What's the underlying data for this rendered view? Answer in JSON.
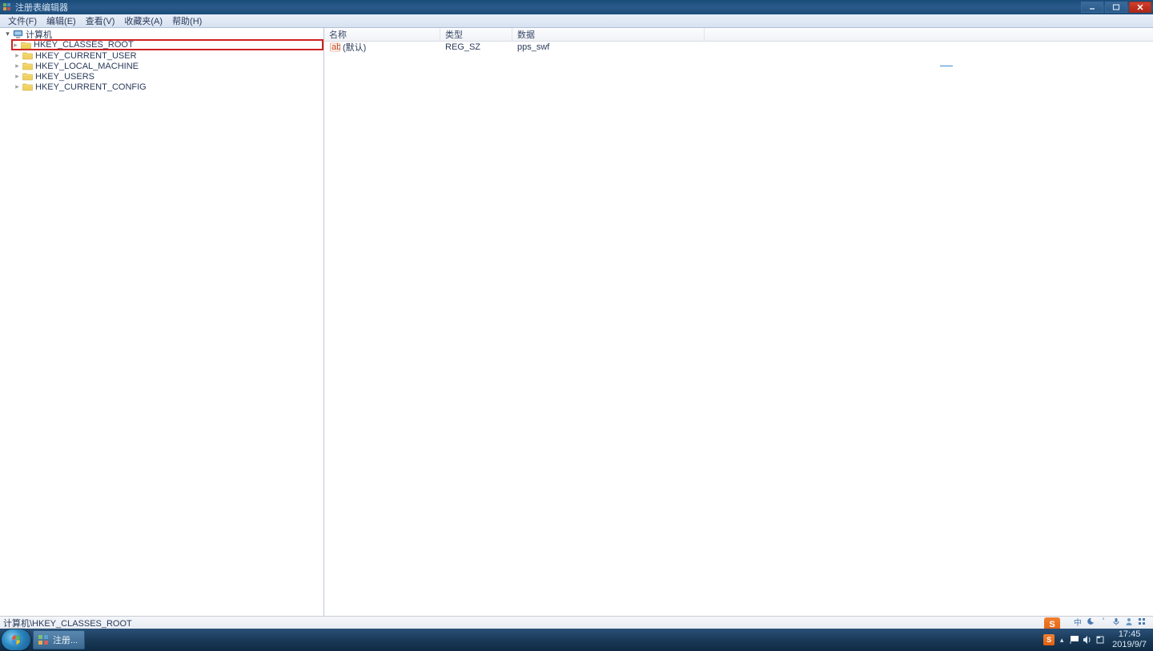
{
  "window": {
    "title": "注册表编辑器"
  },
  "menu": {
    "items": [
      "文件(F)",
      "编辑(E)",
      "查看(V)",
      "收藏夹(A)",
      "帮助(H)"
    ]
  },
  "tree": {
    "root": "计算机",
    "keys": [
      "HKEY_CLASSES_ROOT",
      "HKEY_CURRENT_USER",
      "HKEY_LOCAL_MACHINE",
      "HKEY_USERS",
      "HKEY_CURRENT_CONFIG"
    ]
  },
  "list": {
    "headers": [
      "名称",
      "类型",
      "数据"
    ],
    "row": {
      "name": "(默认)",
      "type": "REG_SZ",
      "data": "pps_swf"
    }
  },
  "status": {
    "path": "计算机\\HKEY_CLASSES_ROOT"
  },
  "taskbar": {
    "app": "注册..."
  },
  "ime": {
    "letter": "S",
    "lang": "中",
    "icons": [
      "moon",
      "comma",
      "mic",
      "person",
      "grid"
    ]
  },
  "systray": {
    "time": "17:45",
    "date": "2019/9/7"
  }
}
